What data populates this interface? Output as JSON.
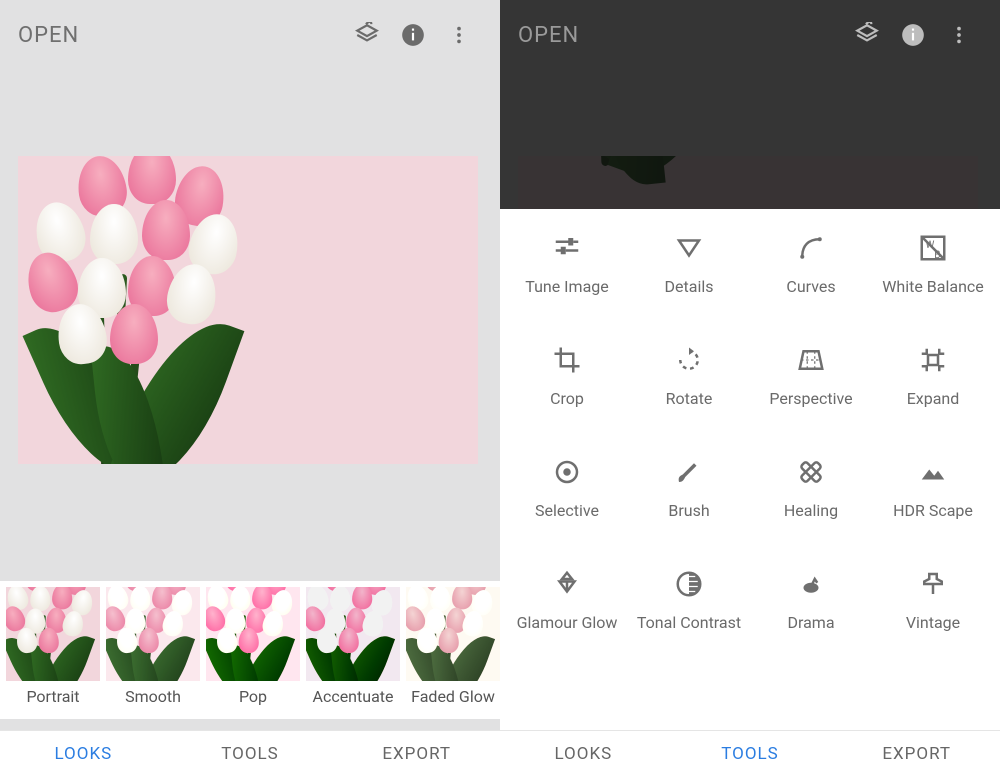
{
  "left": {
    "header": {
      "open": "OPEN"
    },
    "looks": [
      {
        "label": "Portrait"
      },
      {
        "label": "Smooth"
      },
      {
        "label": "Pop"
      },
      {
        "label": "Accentuate"
      },
      {
        "label": "Faded Glow"
      }
    ],
    "tabs": {
      "looks": "LOOKS",
      "tools": "TOOLS",
      "export": "EXPORT",
      "active": "looks"
    }
  },
  "right": {
    "header": {
      "open": "OPEN"
    },
    "tools": [
      {
        "label": "Tune Image",
        "icon": "tune"
      },
      {
        "label": "Details",
        "icon": "details"
      },
      {
        "label": "Curves",
        "icon": "curves"
      },
      {
        "label": "White Balance",
        "icon": "wb"
      },
      {
        "label": "Crop",
        "icon": "crop"
      },
      {
        "label": "Rotate",
        "icon": "rotate"
      },
      {
        "label": "Perspective",
        "icon": "perspective"
      },
      {
        "label": "Expand",
        "icon": "expand"
      },
      {
        "label": "Selective",
        "icon": "selective"
      },
      {
        "label": "Brush",
        "icon": "brush"
      },
      {
        "label": "Healing",
        "icon": "healing"
      },
      {
        "label": "HDR Scape",
        "icon": "hdr"
      },
      {
        "label": "Glamour Glow",
        "icon": "glow"
      },
      {
        "label": "Tonal Contrast",
        "icon": "tonal"
      },
      {
        "label": "Drama",
        "icon": "drama"
      },
      {
        "label": "Vintage",
        "icon": "vintage"
      }
    ],
    "tabs": {
      "looks": "LOOKS",
      "tools": "TOOLS",
      "export": "EXPORT",
      "active": "tools"
    }
  }
}
